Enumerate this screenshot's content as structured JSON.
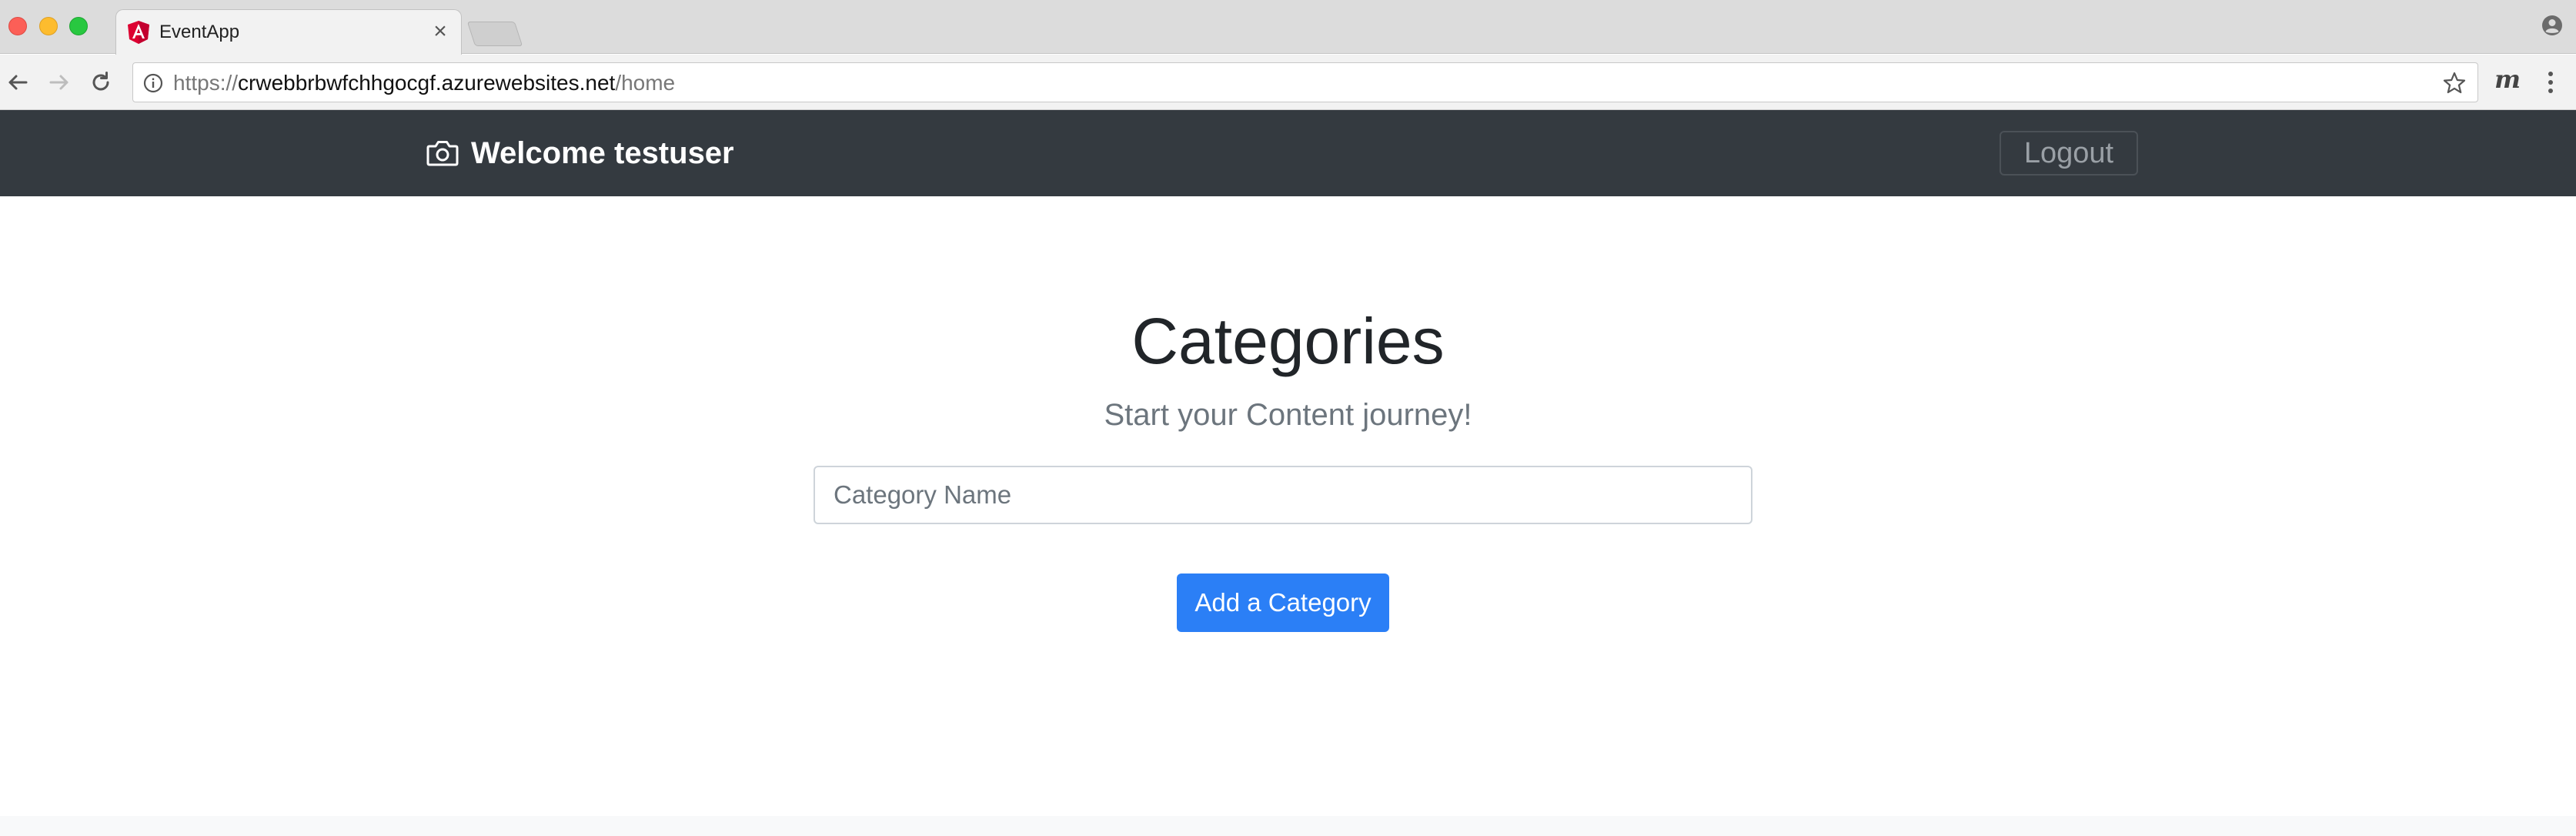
{
  "browser": {
    "tab": {
      "title": "EventApp",
      "close_glyph": "×",
      "favicon": "angular-icon"
    },
    "address": {
      "scheme": "https://",
      "host": "crwebbrbwfchhgocgf.azurewebsites.net",
      "path": "/home"
    },
    "extension_label": "m"
  },
  "navbar": {
    "brand_icon": "camera-icon",
    "brand_text": "Welcome testuser",
    "logout_label": "Logout"
  },
  "main": {
    "title": "Categories",
    "subtitle": "Start your Content journey!",
    "category_input": {
      "placeholder": "Category Name",
      "value": ""
    },
    "add_button_label": "Add a Category"
  },
  "colors": {
    "navbar_bg": "#343a40",
    "primary_button": "#2b7ff6",
    "angular_red": "#dd0031"
  }
}
